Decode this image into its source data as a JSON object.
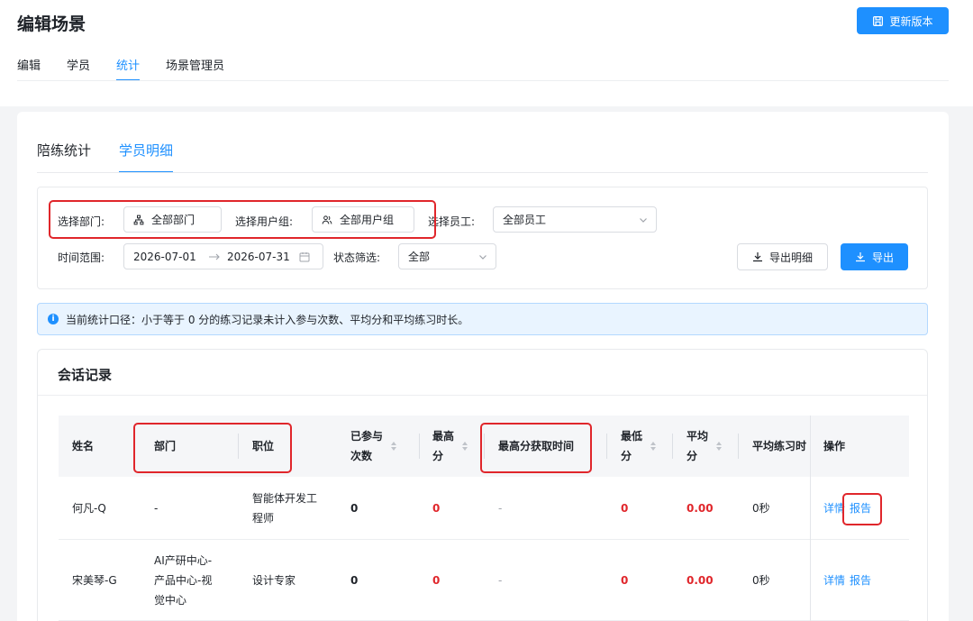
{
  "header": {
    "title": "编辑场景",
    "update_button": "更新版本",
    "tabs": [
      "编辑",
      "学员",
      "统计",
      "场景管理员"
    ],
    "active_tab": 2
  },
  "sub_tabs": {
    "items": [
      "陪练统计",
      "学员明细"
    ],
    "active": 1
  },
  "filters": {
    "dept_label": "选择部门:",
    "dept_value": "全部部门",
    "group_label": "选择用户组:",
    "group_value": "全部用户组",
    "staff_label": "选择员工:",
    "staff_value": "全部员工",
    "time_label": "时间范围:",
    "date_start": "2026-07-01",
    "date_end": "2026-07-31",
    "status_label": "状态筛选:",
    "status_value": "全部",
    "export_detail": "导出明细",
    "export": "导出"
  },
  "notice": "当前统计口径：小于等于 0 分的练习记录未计入参与次数、平均分和平均练习时长。",
  "records": {
    "title": "会话记录",
    "columns": {
      "name": "姓名",
      "dept": "部门",
      "position": "职位",
      "count_1": "已参与",
      "count_2": "次数",
      "max_1": "最高",
      "max_2": "分",
      "max_time": "最高分获取时间",
      "min_1": "最低",
      "min_2": "分",
      "avg_1": "平均",
      "avg_2": "分",
      "avg_duration": "平均练习时",
      "actions": "操作"
    },
    "rows": [
      {
        "name": "何凡-Q",
        "dept_1": "-",
        "dept_2": "",
        "dept_3": "",
        "position_1": "智能体开发工",
        "position_2": "程师",
        "count": "0",
        "max": "0",
        "max_time": "-",
        "min": "0",
        "avg": "0.00",
        "duration": "0秒",
        "detail": "详情",
        "report": "报告"
      },
      {
        "name": "宋美琴-G",
        "dept_1": "AI产研中心-",
        "dept_2": "产品中心-视",
        "dept_3": "觉中心",
        "position_1": "设计专家",
        "position_2": "",
        "count": "0",
        "max": "0",
        "max_time": "-",
        "min": "0",
        "avg": "0.00",
        "duration": "0秒",
        "detail": "详情",
        "report": "报告"
      }
    ]
  },
  "colors": {
    "accent": "#1e90ff",
    "danger": "#e0262b",
    "annotation": "#e0262b"
  },
  "icons": [
    "save-icon",
    "org-icon",
    "users-icon",
    "chevron-down-icon",
    "calendar-icon",
    "arrow-right-icon",
    "download-icon",
    "info-icon",
    "sort-icon"
  ]
}
